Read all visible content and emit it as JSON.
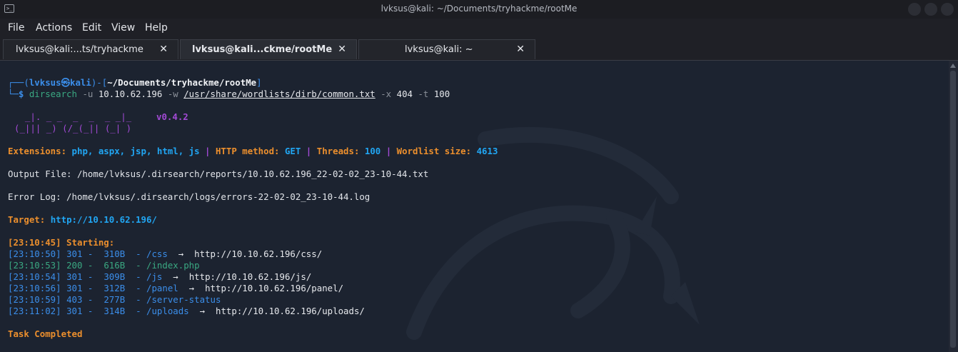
{
  "window": {
    "title": "lvksus@kali: ~/Documents/tryhackme/rootMe"
  },
  "menu": [
    "File",
    "Actions",
    "Edit",
    "View",
    "Help"
  ],
  "tabs": [
    {
      "label": "lvksus@kali:...ts/tryhackme",
      "close": "✕"
    },
    {
      "label": "lvksus@kali...ckme/rootMe",
      "close": "✕"
    },
    {
      "label": "lvksus@kali: ~",
      "close": "✕"
    }
  ],
  "prompt": {
    "corner_top": "┌──(",
    "user": "lvksus",
    "at": "㉿",
    "host": "kali",
    "mid": ")-[",
    "cwd": "~/Documents/tryhackme/rootMe",
    "end": "]",
    "corner_bottom": "└─",
    "dollar": "$ ",
    "cmd": "dirsearch",
    "arg_u": " -u ",
    "target_ip": "10.10.62.196",
    "arg_w": " -w ",
    "wordlist": "/usr/share/wordlists/dirb/common.txt",
    "arg_x": " -x ",
    "x_val": "404",
    "arg_t": " -t ",
    "t_val": "100"
  },
  "banner": {
    "line1": "  _|. _ _  _  _  _ _|_",
    "line2": "(_||| _) (/_(_|| (_| )",
    "version": "v0.4.2"
  },
  "config": {
    "ext_label": "Extensions: ",
    "ext_value": "php, aspx, jsp, html, js",
    "sep": " | ",
    "method_label": "HTTP method: ",
    "method_value": "GET",
    "threads_label": "Threads: ",
    "threads_value": "100",
    "wl_label": "Wordlist size: ",
    "wl_value": "4613"
  },
  "output_file": "Output File: /home/lvksus/.dirsearch/reports/10.10.62.196_22-02-02_23-10-44.txt",
  "error_log": "Error Log: /home/lvksus/.dirsearch/logs/errors-22-02-02_23-10-44.log",
  "target": {
    "label": "Target: ",
    "url": "http://10.10.62.196/"
  },
  "starting": "[23:10:45] Starting:",
  "results": [
    {
      "time": "[23:10:50]",
      "code": "301",
      "size": "310B",
      "path": "/css",
      "redirect": "http://10.10.62.196/css/"
    },
    {
      "time": "[23:10:53]",
      "code": "200",
      "size": "616B",
      "path": "/index.php",
      "redirect": ""
    },
    {
      "time": "[23:10:54]",
      "code": "301",
      "size": "309B",
      "path": "/js",
      "redirect": "http://10.10.62.196/js/"
    },
    {
      "time": "[23:10:56]",
      "code": "301",
      "size": "312B",
      "path": "/panel",
      "redirect": "http://10.10.62.196/panel/"
    },
    {
      "time": "[23:10:59]",
      "code": "403",
      "size": "277B",
      "path": "/server-status",
      "redirect": ""
    },
    {
      "time": "[23:11:02]",
      "code": "301",
      "size": "314B",
      "path": "/uploads",
      "redirect": "http://10.10.62.196/uploads/"
    }
  ],
  "completed": "Task Completed",
  "colors": {
    "terminal_bg": "#1c2330",
    "prompt_blue": "#3b8eea",
    "accent_orange": "#ec8f2d",
    "value_cyan": "#21a6f3",
    "banner_purple": "#a34ad6",
    "ok_green": "#3aa882"
  }
}
